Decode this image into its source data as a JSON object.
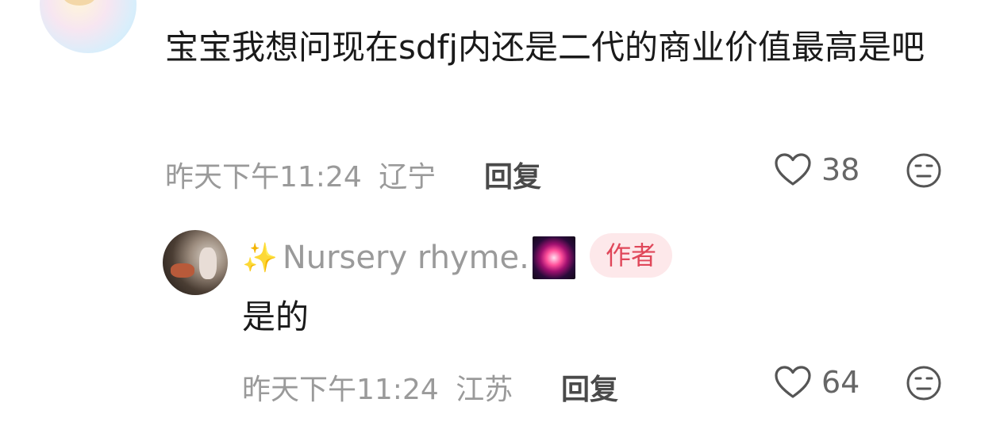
{
  "comment": {
    "text": "宝宝我想问现在sdfj内还是二代的商业价值最高是吧",
    "time": "昨天下午11:24",
    "location": "辽宁",
    "reply_label": "回复",
    "likes": "38",
    "like_icon": "heart-icon",
    "dislike_icon": "neutral-face-icon"
  },
  "reply": {
    "username_prefix": "✨",
    "username": "Nursery rhyme.",
    "username_suffix_icon": "firework-emoji",
    "author_tag": "作者",
    "text": "是的",
    "time": "昨天下午11:24",
    "location": "江苏",
    "reply_label": "回复",
    "likes": "64",
    "like_icon": "heart-icon",
    "dislike_icon": "neutral-face-icon"
  },
  "colors": {
    "text_primary": "#1a1a1a",
    "text_meta": "#9a9a9a",
    "author_tag_bg": "#fde8ea",
    "author_tag_text": "#e0475a"
  }
}
